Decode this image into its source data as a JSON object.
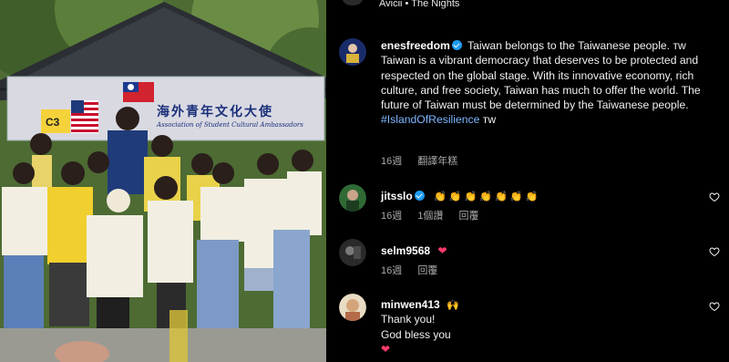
{
  "top": {
    "song": "Avicii • The Nights"
  },
  "post": {
    "username": "enesfreedom",
    "text_line1": "Taiwan belongs to the Taiwanese people. ᴛᴡ",
    "text_body": "Taiwan is a vibrant democracy that deserves to be protected and respected on the global stage. With its innovative economy, rich culture, and free society, Taiwan has much to offer the world. The future of Taiwan must be determined by the Taiwanese people.",
    "hashtag": "#IslandOfResilience",
    "hashtag_suffix": " ᴛᴡ",
    "age": "16週",
    "translate": "翻譯年糕"
  },
  "photo": {
    "booth_label": "C3",
    "banner_text": "海外青年文化大使",
    "banner_sub": "Association of Student Cultural Ambassadors"
  },
  "comments": [
    {
      "username": "jitsslo",
      "text": "👏 👏 👏 👏 👏 👏 👏",
      "age": "16週",
      "likes": "1個讚",
      "reply": "回覆"
    },
    {
      "username": "selm9568",
      "text": "❤",
      "age": "16週",
      "reply": "回覆"
    },
    {
      "username": "minwen413",
      "emoji": "🙌",
      "line1": "Thank you!",
      "line2": "God bless you",
      "line3": "❤"
    }
  ],
  "colors": {
    "accent_blue": "#1d9bf0",
    "hashtag": "#7eb6ff",
    "heart": "#ff3b6b",
    "meta_gray": "#a8a8a8",
    "clap": "#f5c518"
  }
}
